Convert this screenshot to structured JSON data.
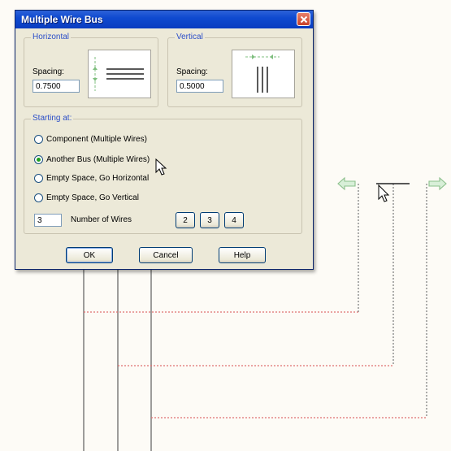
{
  "dialog": {
    "title": "Multiple Wire Bus",
    "horizontal": {
      "legend": "Horizontal",
      "spacing_label": "Spacing:",
      "spacing_value": "0.7500"
    },
    "vertical": {
      "legend": "Vertical",
      "spacing_label": "Spacing:",
      "spacing_value": "0.5000"
    },
    "starting_at": {
      "legend": "Starting at:",
      "options": [
        {
          "label": "Component (Multiple Wires)",
          "checked": false
        },
        {
          "label": "Another Bus (Multiple Wires)",
          "checked": true
        },
        {
          "label": "Empty Space, Go Horizontal",
          "checked": false
        },
        {
          "label": "Empty Space, Go Vertical",
          "checked": false
        }
      ]
    },
    "wires": {
      "value": "3",
      "label": "Number of Wires",
      "presets": [
        "2",
        "3",
        "4"
      ]
    },
    "buttons": {
      "ok": "OK",
      "cancel": "Cancel",
      "help": "Help"
    }
  },
  "colors": {
    "titlebar": "#0a3cc0",
    "wire_dotted": "#e07070",
    "bus_arrow": "#9ccc9c"
  }
}
